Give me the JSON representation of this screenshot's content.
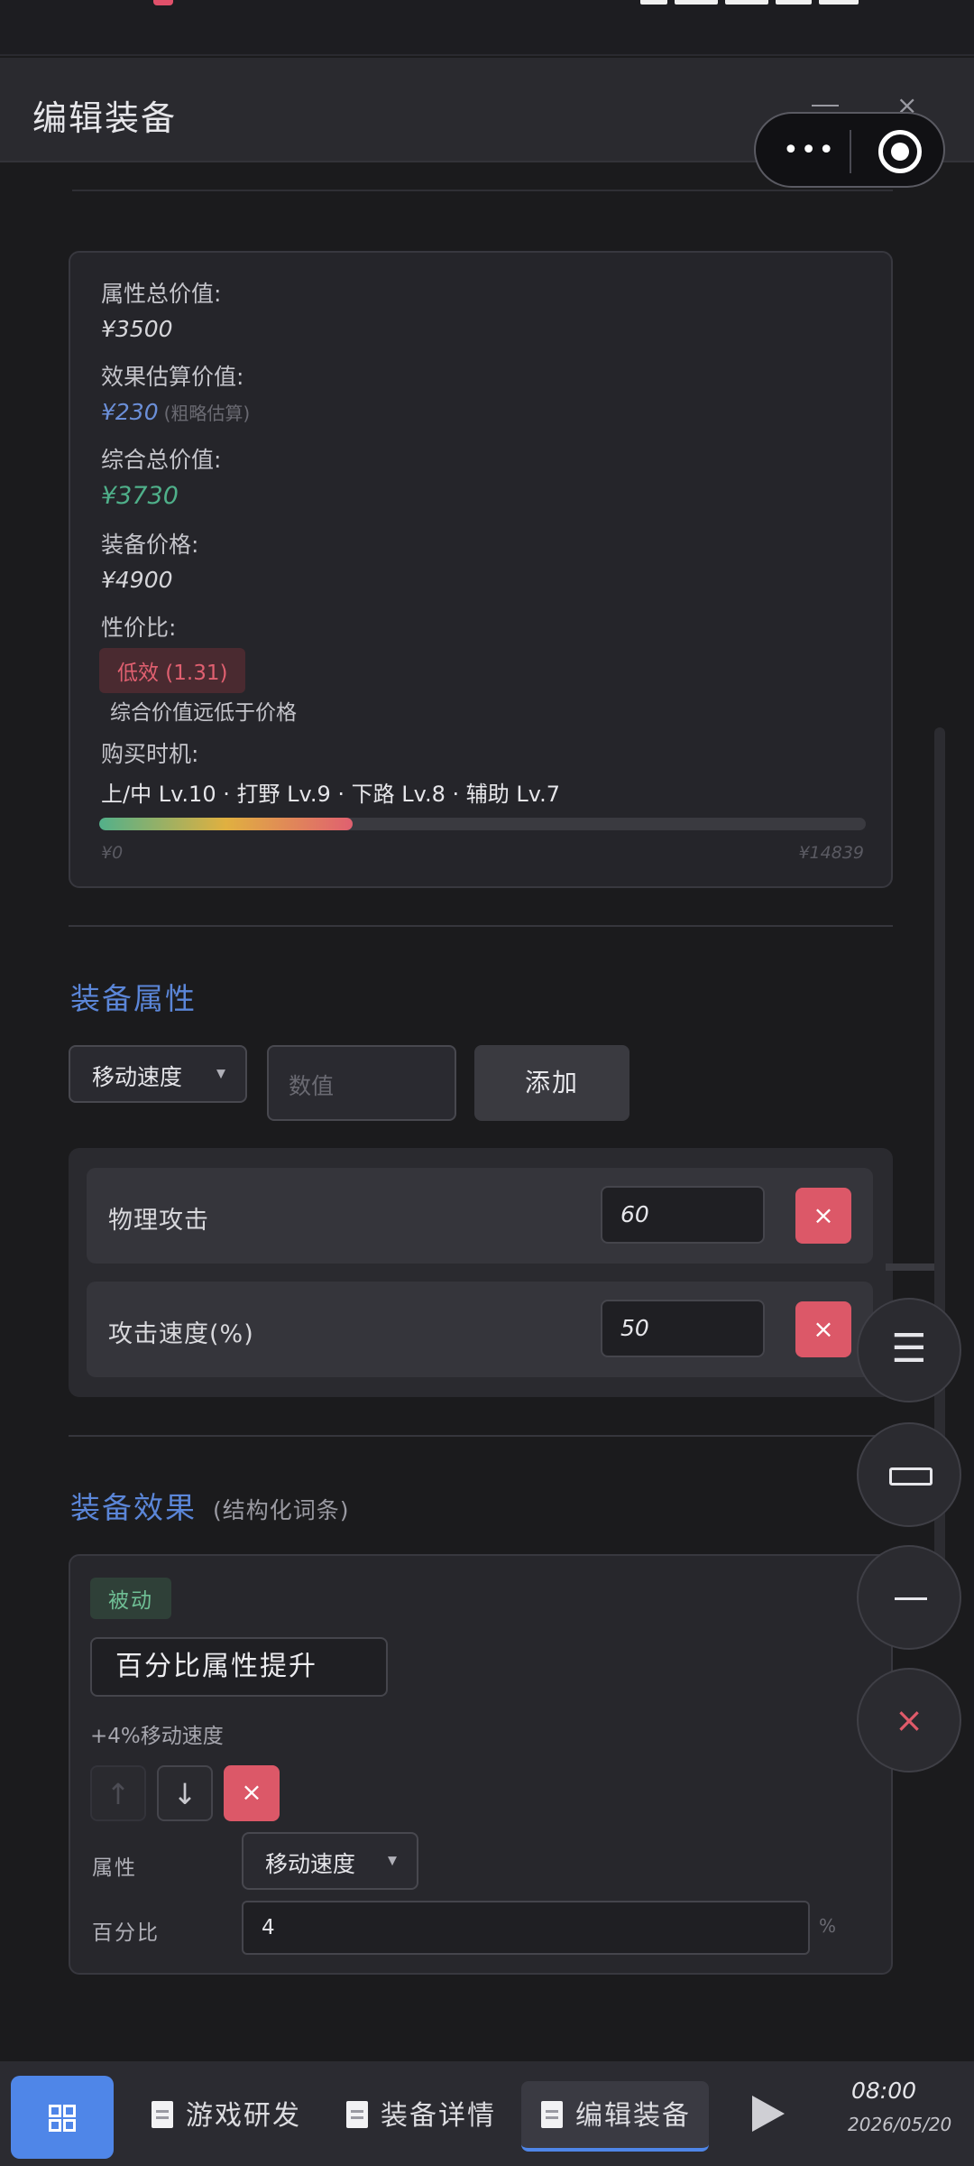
{
  "header": {
    "title": "编辑装备"
  },
  "value_summary": {
    "attr_total_label": "属性总价值:",
    "attr_total_value": "¥3500",
    "effect_est_label": "效果估算价值:",
    "effect_est_value": "¥230",
    "effect_est_hint": "(粗略估算)",
    "combined_label": "综合总价值:",
    "combined_value": "¥3730",
    "price_label": "装备价格:",
    "price_value": "¥4900",
    "ratio_label": "性价比:",
    "ratio_badge": "低效 (1.31)",
    "ratio_note": "综合价值远低于价格",
    "timing_label": "购买时机:",
    "timing_value": "上/中 Lv.10 · 打野 Lv.9 · 下路 Lv.8 · 辅助 Lv.7",
    "progress_fraction": 0.33,
    "range_min": "¥0",
    "range_max": "¥14839"
  },
  "attributes": {
    "title": "装备属性",
    "select_value": "移动速度",
    "value_placeholder": "数值",
    "add_label": "添加",
    "items": [
      {
        "name": "物理攻击",
        "value": "60",
        "delete": "×"
      },
      {
        "name": "攻击速度(%)",
        "value": "50",
        "delete": "×"
      }
    ]
  },
  "effects": {
    "title": "装备效果",
    "subtitle": "(结构化词条)",
    "card": {
      "tag": "被动",
      "name": "百分比属性提升",
      "description": "+4%移动速度",
      "up_glyph": "↑",
      "down_glyph": "↓",
      "delete_glyph": "×",
      "attr_label": "属性",
      "attr_value": "移动速度",
      "pct_label": "百分比",
      "pct_value": "4",
      "pct_unit": "%"
    }
  },
  "fabs": {
    "menu_glyph": "☰",
    "close_glyph": "×"
  },
  "taskbar": {
    "tasks": [
      "游戏研发",
      "装备详情",
      "编辑装备"
    ],
    "time": "08:00",
    "date": "2026/05/20"
  },
  "colors": {
    "accent": "#4f86e8",
    "danger": "#dc5868",
    "success": "#4fb08a",
    "section_title": "#5b86d8"
  }
}
